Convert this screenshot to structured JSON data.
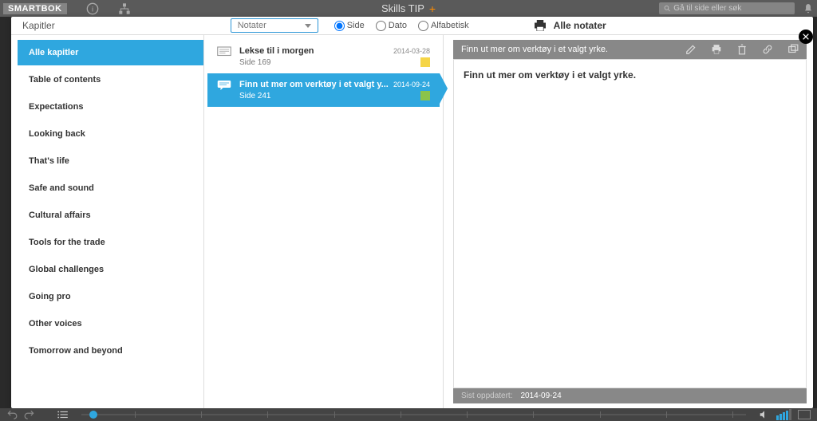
{
  "topbar": {
    "logo_a": "SMART",
    "logo_b": "BOK",
    "title": "Skills TIP",
    "search_placeholder": "Gå til side eller søk"
  },
  "panel": {
    "title": "Kapitler",
    "dropdown_value": "Notater",
    "radio": {
      "side": "Side",
      "dato": "Dato",
      "alfa": "Alfabetisk"
    },
    "all_notes": "Alle notater"
  },
  "sidebar": {
    "items": [
      "Alle kapitler",
      "Table of contents",
      "Expectations",
      "Looking back",
      "That's life",
      "Safe and sound",
      "Cultural affairs",
      "Tools for the trade",
      "Global challenges",
      "Going pro",
      "Other voices",
      "Tomorrow and beyond"
    ]
  },
  "notes": [
    {
      "title": "Lekse til i morgen",
      "date": "2014-03-28",
      "page": "Side 169",
      "swatch": "yellow",
      "active": false
    },
    {
      "title": "Finn ut mer om verktøy i et valgt y...",
      "date": "2014-09-24",
      "page": "Side 241",
      "swatch": "green",
      "active": true
    }
  ],
  "detail": {
    "header_title": "Finn ut mer om verktøy i et valgt yrke.",
    "body": "Finn ut mer om verktøy i et valgt yrke.",
    "footer_label": "Sist oppdatert:",
    "footer_date": "2014-09-24"
  }
}
